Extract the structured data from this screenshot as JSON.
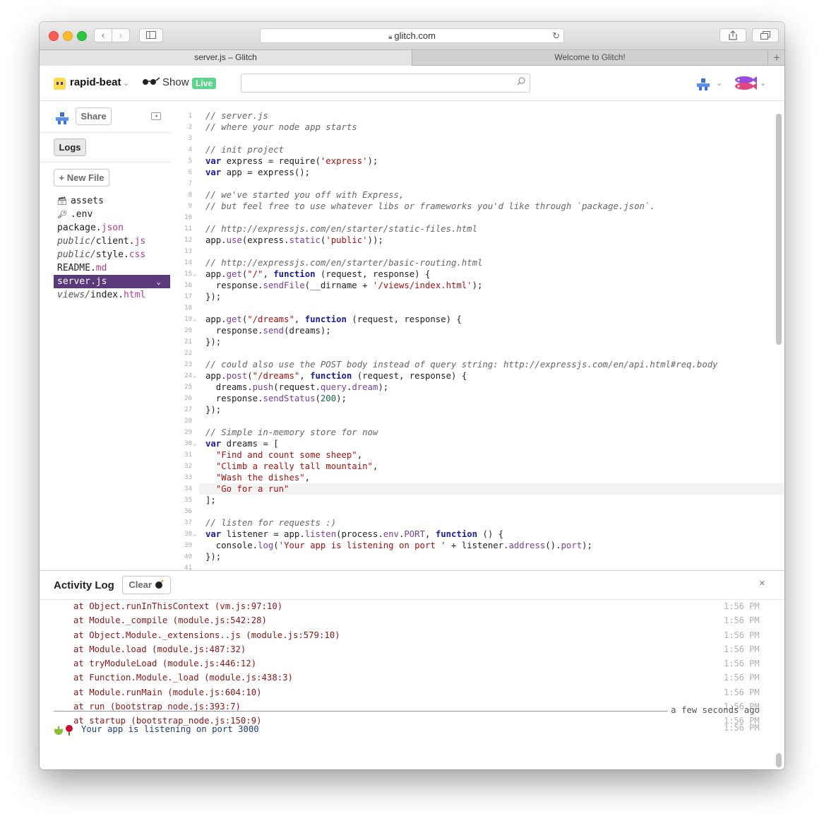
{
  "browser": {
    "url": "glitch.com",
    "tabs": [
      "server.js – Glitch",
      "Welcome to Glitch!"
    ]
  },
  "header": {
    "project_name": "rapid-beat",
    "show_label": "Show",
    "live_badge": "Live",
    "search_placeholder": ""
  },
  "sidebar": {
    "share_label": "Share",
    "logs_label": "Logs",
    "new_file_label": "+ New File",
    "files": [
      {
        "dir": "",
        "name": "assets",
        "ext": "",
        "icon": "archive-icon"
      },
      {
        "dir": "",
        "name": ".env",
        "ext": "",
        "icon": "key-icon"
      },
      {
        "dir": "",
        "name": "package.",
        "ext": "json"
      },
      {
        "dir": "public/",
        "name": "client.",
        "ext": "js"
      },
      {
        "dir": "public/",
        "name": "style.",
        "ext": "css"
      },
      {
        "dir": "",
        "name": "README.",
        "ext": "md"
      },
      {
        "dir": "",
        "name": "server.",
        "ext": "js",
        "active": true
      },
      {
        "dir": "views/",
        "name": "index.",
        "ext": "html"
      }
    ]
  },
  "editor": {
    "lines": [
      "// server.js",
      "// where your node app starts",
      "",
      "// init project",
      "var express = require('express');",
      "var app = express();",
      "",
      "// we've started you off with Express,",
      "// but feel free to use whatever libs or frameworks you'd like through `package.json`.",
      "",
      "// http://expressjs.com/en/starter/static-files.html",
      "app.use(express.static('public'));",
      "",
      "// http://expressjs.com/en/starter/basic-routing.html",
      "app.get(\"/\", function (request, response) {",
      "  response.sendFile(__dirname + '/views/index.html');",
      "});",
      "",
      "app.get(\"/dreams\", function (request, response) {",
      "  response.send(dreams);",
      "});",
      "",
      "// could also use the POST body instead of query string: http://expressjs.com/en/api.html#req.body",
      "app.post(\"/dreams\", function (request, response) {",
      "  dreams.push(request.query.dream);",
      "  response.sendStatus(200);",
      "});",
      "",
      "// Simple in-memory store for now",
      "var dreams = [",
      "  \"Find and count some sheep\",",
      "  \"Climb a really tall mountain\",",
      "  \"Wash the dishes\",",
      "  \"Go for a run\"",
      "];",
      "",
      "// listen for requests :)",
      "var listener = app.listen(process.env.PORT, function () {",
      "  console.log('Your app is listening on port ' + listener.address().port);",
      "});",
      ""
    ],
    "fold_lines": [
      15,
      19,
      24,
      30,
      38
    ],
    "highlight_line": 34
  },
  "activity_log": {
    "title": "Activity Log",
    "clear_label": "Clear",
    "close_label": "×",
    "entries": [
      {
        "msg": "at Object.runInThisContext (vm.js:97:10)",
        "time": "1:56 PM"
      },
      {
        "msg": "at Module._compile (module.js:542:28)",
        "time": "1:56 PM"
      },
      {
        "msg": "at Object.Module._extensions..js (module.js:579:10)",
        "time": "1:56 PM"
      },
      {
        "msg": "at Module.load (module.js:487:32)",
        "time": "1:56 PM"
      },
      {
        "msg": "at tryModuleLoad (module.js:446:12)",
        "time": "1:56 PM"
      },
      {
        "msg": "at Function.Module._load (module.js:438:3)",
        "time": "1:56 PM"
      },
      {
        "msg": "at Module.runMain (module.js:604:10)",
        "time": "1:56 PM"
      },
      {
        "msg": "at run (bootstrap_node.js:393:7)",
        "time": "1:56 PM"
      },
      {
        "msg": "at startup (bootstrap_node.js:150:9)",
        "time": "1:56 PM"
      }
    ],
    "divider_label": "a few seconds ago",
    "final_message": "Your app is listening on port 3000",
    "final_time": "1:56 PM"
  },
  "colors": {
    "active_file_bg": "#5a3a7a",
    "live_badge": "#5ed48e",
    "error_text": "#8b1717",
    "info_text": "#223e7a"
  }
}
